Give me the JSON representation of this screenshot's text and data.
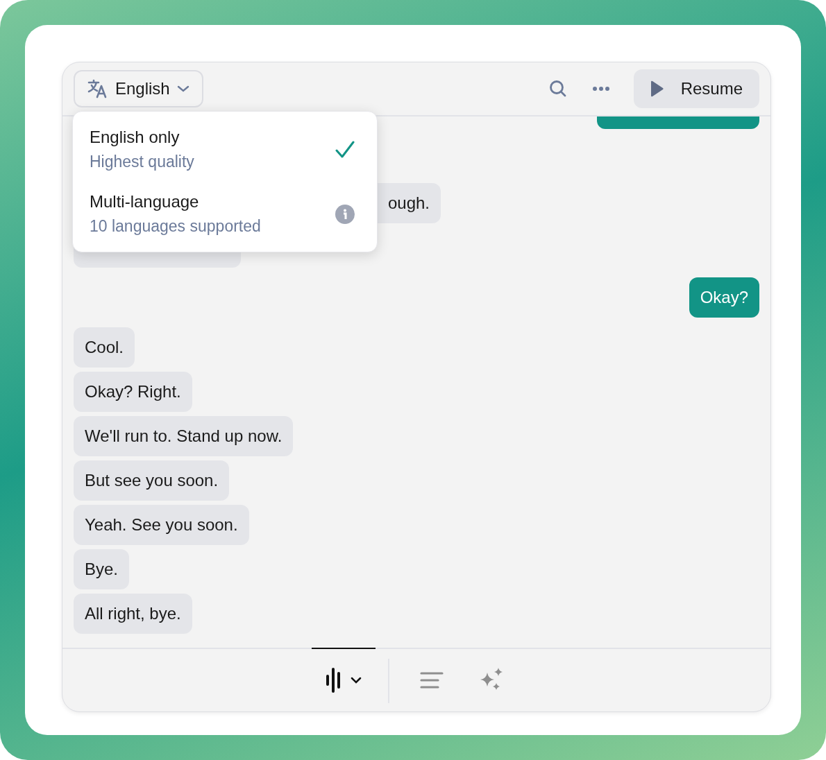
{
  "header": {
    "language_button": {
      "label": "English"
    },
    "resume_button": {
      "label": "Resume"
    }
  },
  "language_menu": [
    {
      "title": "English only",
      "subtitle": "Highest quality",
      "selected": true
    },
    {
      "title": "Multi-language",
      "subtitle": "10 languages supported",
      "selected": false
    }
  ],
  "messages": [
    {
      "outgoing": true,
      "kind": "cut-top"
    },
    {
      "outgoing": false,
      "kind": "covered-left",
      "text": "ough."
    },
    {
      "outgoing": false,
      "kind": "covered-top"
    },
    {
      "outgoing": true,
      "text": "Okay?"
    },
    {
      "outgoing": false,
      "text": "Cool."
    },
    {
      "outgoing": false,
      "text": "Okay? Right."
    },
    {
      "outgoing": false,
      "text": "We'll run to. Stand up now."
    },
    {
      "outgoing": false,
      "text": "But see you soon."
    },
    {
      "outgoing": false,
      "text": "Yeah. See you soon."
    },
    {
      "outgoing": false,
      "text": "Bye."
    },
    {
      "outgoing": false,
      "text": "All right, bye."
    }
  ],
  "footer_tabs": [
    {
      "kind": "waveform",
      "selected": true
    },
    {
      "kind": "lines",
      "selected": false
    },
    {
      "kind": "sparkle",
      "selected": false
    }
  ]
}
